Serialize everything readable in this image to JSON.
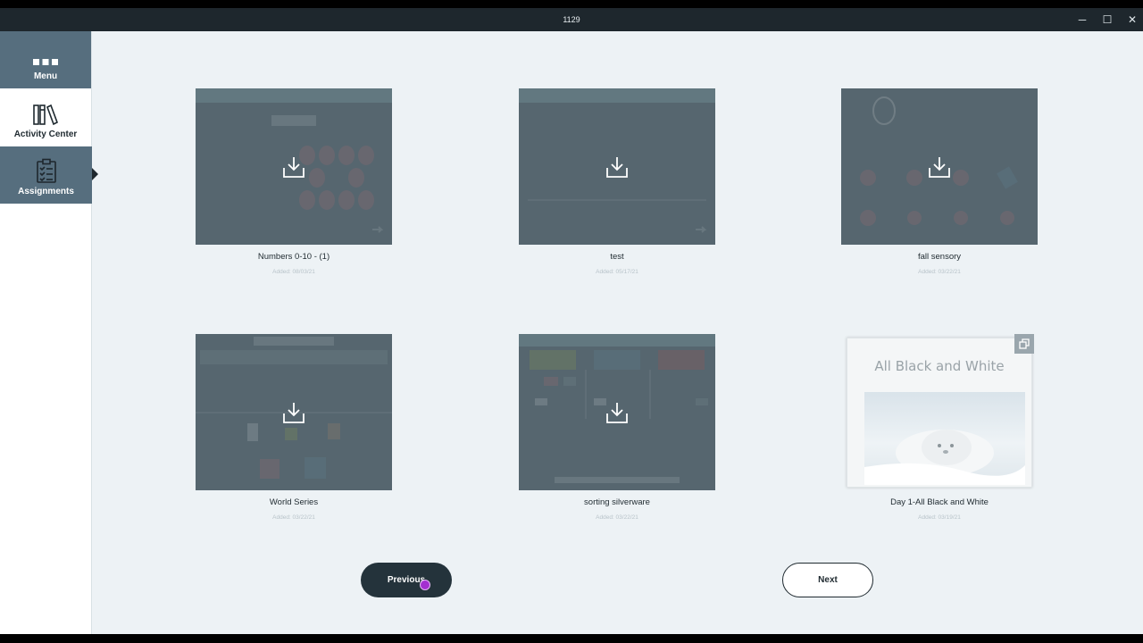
{
  "window": {
    "title": "1129",
    "minimize": "─",
    "maximize": "☐",
    "close": "✕"
  },
  "sidebar": {
    "items": [
      {
        "label": "Menu",
        "icon": "menu-dots-icon"
      },
      {
        "label": "Activity Center",
        "icon": "books-icon"
      },
      {
        "label": "Assignments",
        "icon": "clipboard-checklist-icon",
        "active": true
      }
    ]
  },
  "cards": [
    {
      "name": "Numbers 0-10 - (1)",
      "date": "Added: 08/03/21",
      "status": "download"
    },
    {
      "name": "test",
      "date": "Added: 05/17/21",
      "status": "download"
    },
    {
      "name": "fall sensory",
      "date": "Added: 03/22/21",
      "status": "download"
    },
    {
      "name": "World Series",
      "date": "Added: 03/22/21",
      "status": "download"
    },
    {
      "name": "sorting silverware",
      "date": "Added: 03/22/21",
      "status": "download"
    },
    {
      "name": "Day 1-All Black and White",
      "date": "Added: 03/19/21",
      "status": "downloaded",
      "preview_title": "All Black and White"
    }
  ],
  "pagination": {
    "previous": "Previous",
    "next": "Next"
  },
  "colors": {
    "sidebar_active": "#566e7e",
    "titlebar": "#1e272d",
    "content_bg": "#edf2f5",
    "thumb_overlay": "#56666f"
  }
}
